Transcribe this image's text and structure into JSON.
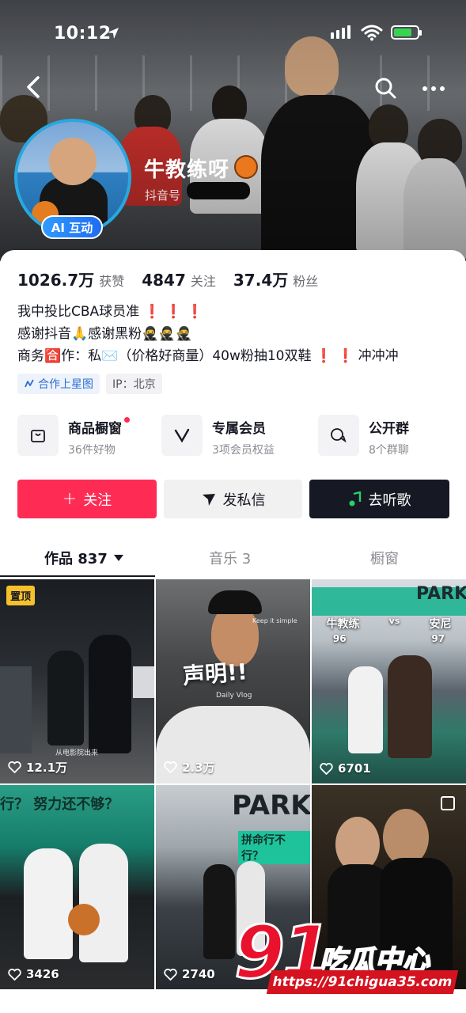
{
  "status_bar": {
    "time": "10:12"
  },
  "profile": {
    "name": "牛教练呀",
    "douyin_id_label": "抖音号",
    "ai_badge": "AI 互动"
  },
  "stats": [
    {
      "value": "1026.7万",
      "label": "获赞"
    },
    {
      "value": "4847",
      "label": "关注"
    },
    {
      "value": "37.4万",
      "label": "粉丝"
    }
  ],
  "bio": {
    "line1": "我中投比CBA球员准",
    "line1_marks": "❗ ❗ ❗",
    "line2": "感谢抖音🙏感谢黑粉🥷🥷🥷",
    "line3_a": "商务🈴作：私✉️（价格好商量）40w粉抽10双鞋",
    "line3_marks": "❗ ❗",
    "line3_b": "冲冲冲"
  },
  "tags": [
    {
      "label": "合作上星图"
    },
    {
      "label": "IP：北京"
    }
  ],
  "features": [
    {
      "title": "商品橱窗",
      "subtitle": "36件好物"
    },
    {
      "title": "专属会员",
      "subtitle": "3项会员权益"
    },
    {
      "title": "公开群",
      "subtitle": "8个群聊"
    }
  ],
  "actions": {
    "follow": "关注",
    "message": "发私信",
    "music": "去听歌"
  },
  "tabs": {
    "works": "作品 837",
    "music": "音乐 3",
    "window": "橱窗"
  },
  "videos": [
    {
      "likes": "12.1万",
      "pinned_label": "置顶",
      "caption": "从电影院出来"
    },
    {
      "likes": "2.3万",
      "caption": "声明!!",
      "overlay_top": "Keep it simple",
      "overlay_sub": "Daily Vlog"
    },
    {
      "likes": "6701",
      "left_name": "牛教练",
      "vs": "vs",
      "right_name": "安尼",
      "left_score": "96",
      "right_score": "97",
      "sign": "PARK"
    },
    {
      "likes": "3426",
      "sign": "行？ 努力还不够？"
    },
    {
      "likes": "2740",
      "sign": "PARK",
      "banner": "拼命行不行？"
    },
    {
      "likes": ""
    }
  ],
  "watermark": {
    "number": "91",
    "text": "吃瓜中心",
    "url": "https://91chigua35.com"
  },
  "colors": {
    "accent": "#fe2c55",
    "dark_button": "#161823",
    "avatar_ring": "#28a8e0",
    "watermark_red": "#e8122d"
  }
}
